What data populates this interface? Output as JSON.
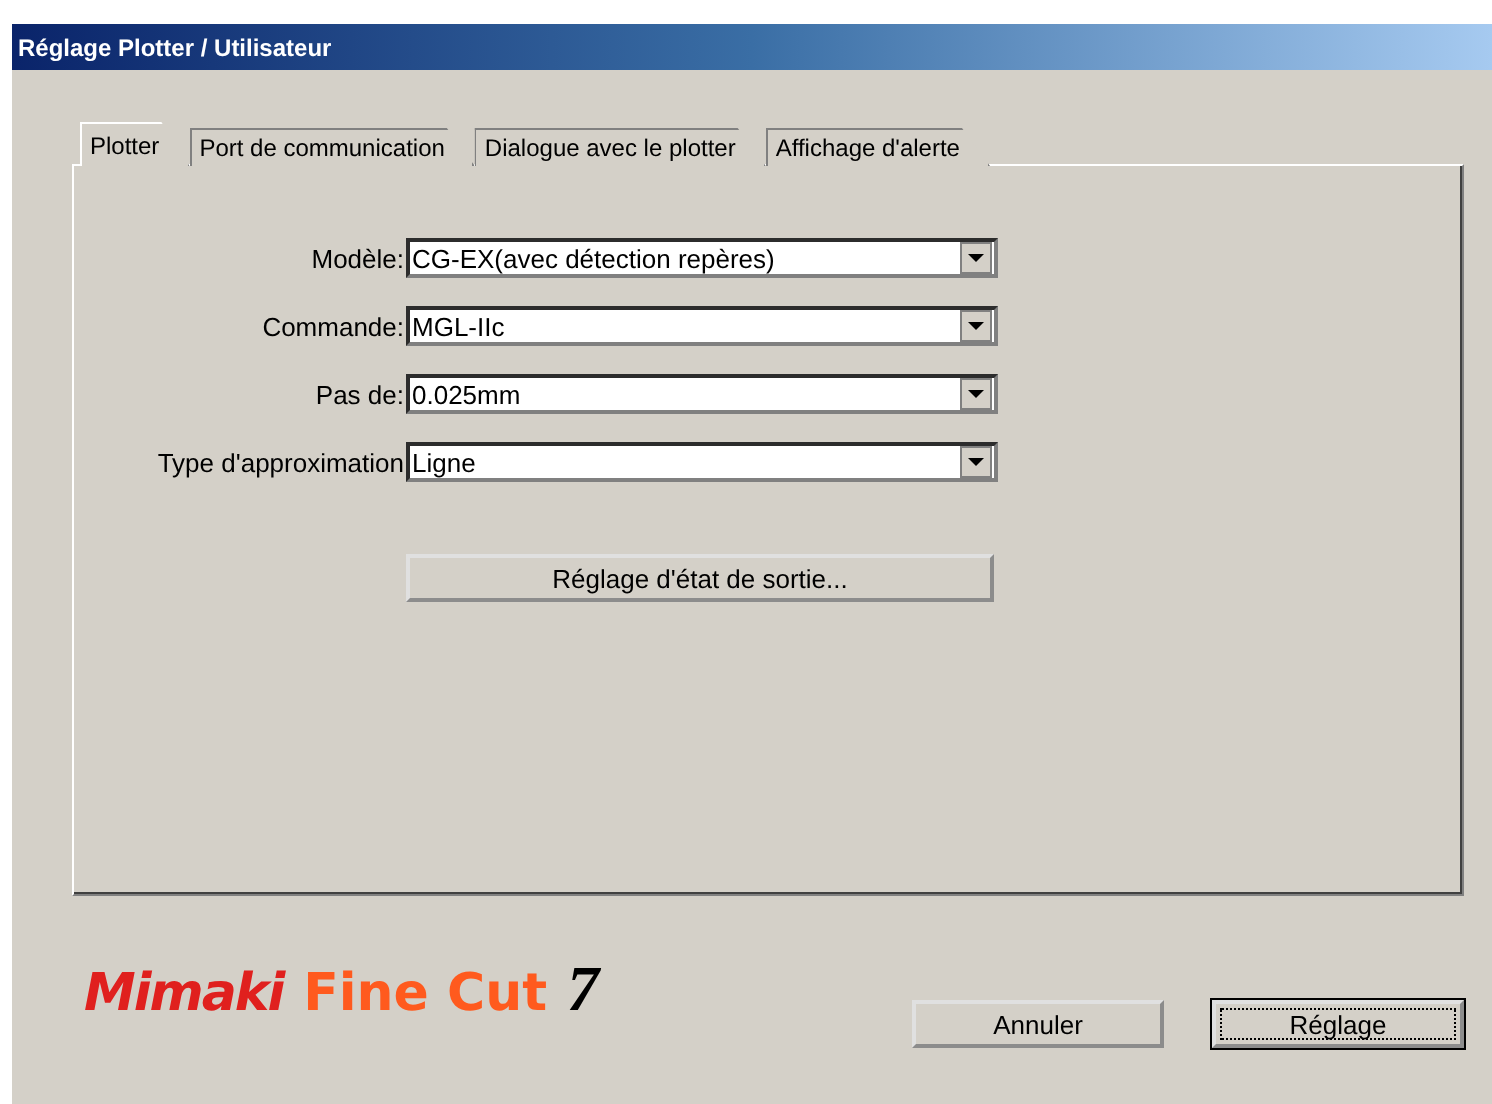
{
  "window": {
    "title": "Réglage Plotter / Utilisateur"
  },
  "tabs": [
    {
      "label": "Plotter",
      "selected": true
    },
    {
      "label": "Port de communication",
      "selected": false
    },
    {
      "label": "Dialogue avec le plotter",
      "selected": false
    },
    {
      "label": "Affichage d'alerte",
      "selected": false
    }
  ],
  "fields": [
    {
      "label": "Modèle:",
      "value": "CG-EX(avec détection repères)"
    },
    {
      "label": "Commande:",
      "value": "MGL-IIc"
    },
    {
      "label": "Pas de:",
      "value": "0.025mm"
    },
    {
      "label": "Type d'approximation",
      "value": "Ligne"
    }
  ],
  "output_button": "Réglage d'état de sortie...",
  "logo": {
    "brand": "Mimaki",
    "product": "Fine Cut",
    "version": "7"
  },
  "buttons": [
    {
      "label": "Annuler",
      "default": false
    },
    {
      "label": "Réglage",
      "default": true
    }
  ]
}
